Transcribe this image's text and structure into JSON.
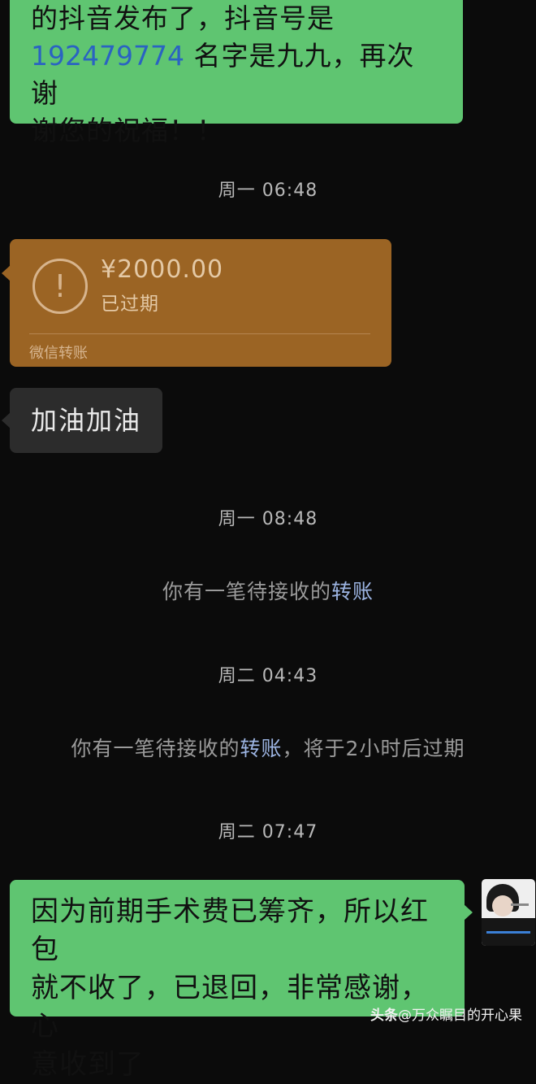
{
  "messages": {
    "top_bubble": {
      "line1": "的抖音发布了，抖音号是",
      "number": "192479774",
      "line2_rest": " 名字是九九，再次谢",
      "line3": "谢您的祝福！！"
    },
    "timestamp1": "周一 06:48",
    "transfer": {
      "amount": "¥2000.00",
      "status": "已过期",
      "footer": "微信转账"
    },
    "gray_bubble": "加油加油",
    "timestamp2": "周一 08:48",
    "system1": {
      "prefix": "你有一笔待接收的",
      "link": "转账"
    },
    "timestamp3": "周二 04:43",
    "system2": {
      "prefix": "你有一笔待接收的",
      "link": "转账",
      "suffix": "，将于2小时后过期"
    },
    "timestamp4": "周二 07:47",
    "bottom_bubble": {
      "line1": "因为前期手术费已筹齐，所以红包",
      "line2": "就不收了，已退回，非常感谢，心",
      "line3": "意收到了"
    }
  },
  "watermark": {
    "brand": "头条",
    "account": "@万众瞩目的开心果"
  },
  "icons": {
    "warning": "exclamation-circle-icon"
  },
  "colors": {
    "background": "#0b0b0b",
    "green_bubble": "#5fc571",
    "transfer_card": "#9b6424",
    "gray_bubble": "#2c2c2c",
    "link_blue": "#9cb4e2"
  }
}
